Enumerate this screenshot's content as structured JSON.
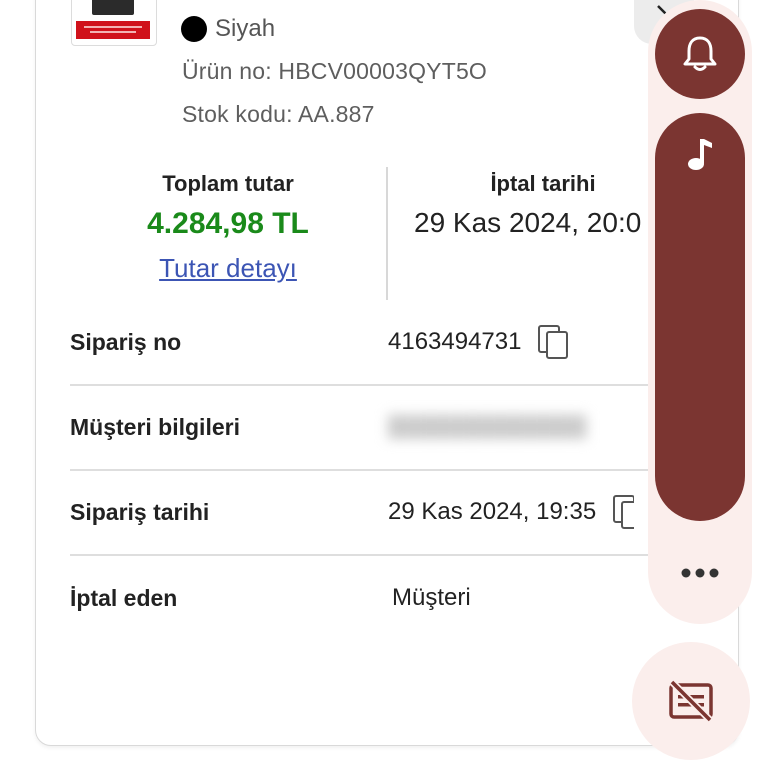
{
  "product": {
    "color_label": "Siyah",
    "product_no": "Ürün no: HBCV00003QYT5O",
    "stock_code": "Stok kodu: AA.887"
  },
  "totals": {
    "total_label": "Toplam tutar",
    "total_amount": "4.284,98 TL",
    "detail_link": "Tutar detayı",
    "cancel_date_label": "İptal tarihi",
    "cancel_date_value": "29 Kas 2024, 20:0"
  },
  "details": {
    "order_no_label": "Sipariş no",
    "order_no_value": "4163494731",
    "customer_label": "Müşteri bilgileri",
    "order_date_label": "Sipariş tarihi",
    "order_date_value": "29 Kas 2024, 19:35",
    "cancelled_by_label": "İptal eden",
    "cancelled_by_value": "Müşteri"
  },
  "colors": {
    "accent_green": "#1a8a1a",
    "link_blue": "#3c55b4",
    "fab_maroon": "#7b3531",
    "fab_panel": "#fbeeec"
  },
  "icons": {
    "copy": "copy-icon",
    "bell": "bell-icon",
    "music": "music-note-icon",
    "more": "more-horizontal-icon",
    "captions_off": "captions-off-icon",
    "chevron": "chevron-right-icon"
  }
}
